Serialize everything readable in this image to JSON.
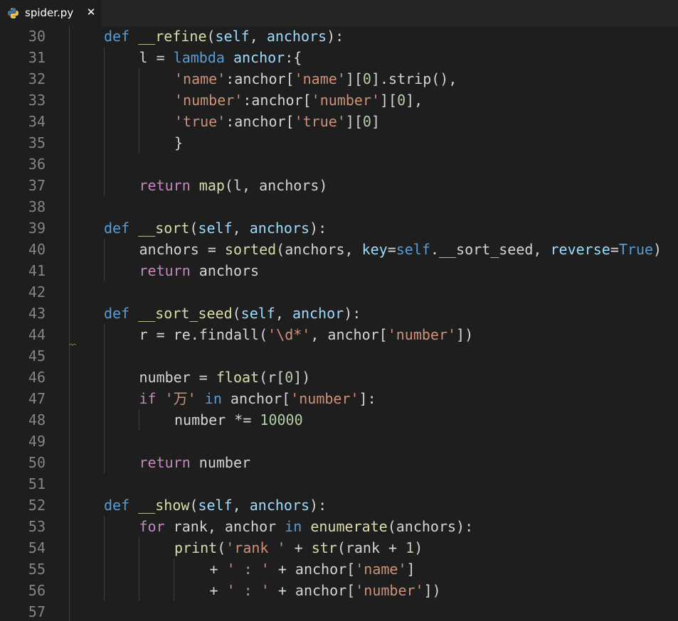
{
  "tab": {
    "filename": "spider.py",
    "close_glyph": "✕",
    "icon": "python-icon"
  },
  "colors": {
    "background": "#1e1e1e",
    "keyword": "#569cd6",
    "control": "#c586c0",
    "function": "#dcdcaa",
    "parameter": "#9cdcfe",
    "string": "#ce9178",
    "number": "#b5cea8",
    "line_number": "#858585"
  },
  "code_lines": [
    {
      "num": "30",
      "tokens": [
        [
          "kw",
          "def"
        ],
        [
          "p",
          " "
        ],
        [
          "fn",
          "__refine"
        ],
        [
          "p",
          "("
        ],
        [
          "param",
          "self"
        ],
        [
          "p",
          ", "
        ],
        [
          "param",
          "anchors"
        ],
        [
          "p",
          "):"
        ]
      ],
      "indent": 0
    },
    {
      "num": "31",
      "tokens": [
        [
          "p",
          "l = "
        ],
        [
          "kw",
          "lambda"
        ],
        [
          "p",
          " "
        ],
        [
          "param",
          "anchor"
        ],
        [
          "p",
          ":{"
        ]
      ],
      "indent": 1
    },
    {
      "num": "32",
      "tokens": [
        [
          "str",
          "'name'"
        ],
        [
          "p",
          ":anchor["
        ],
        [
          "str",
          "'name'"
        ],
        [
          "p",
          "]["
        ],
        [
          "num",
          "0"
        ],
        [
          "p",
          "].strip(),"
        ]
      ],
      "indent": 2
    },
    {
      "num": "33",
      "tokens": [
        [
          "str",
          "'number'"
        ],
        [
          "p",
          ":anchor["
        ],
        [
          "str",
          "'number'"
        ],
        [
          "p",
          "]["
        ],
        [
          "num",
          "0"
        ],
        [
          "p",
          "],"
        ]
      ],
      "indent": 2
    },
    {
      "num": "34",
      "tokens": [
        [
          "str",
          "'true'"
        ],
        [
          "p",
          ":anchor["
        ],
        [
          "str",
          "'true'"
        ],
        [
          "p",
          "]["
        ],
        [
          "num",
          "0"
        ],
        [
          "p",
          "]"
        ]
      ],
      "indent": 2
    },
    {
      "num": "35",
      "tokens": [
        [
          "p",
          "}"
        ]
      ],
      "indent": 2
    },
    {
      "num": "36",
      "tokens": [],
      "indent": 0
    },
    {
      "num": "37",
      "tokens": [
        [
          "ctl",
          "return"
        ],
        [
          "p",
          " "
        ],
        [
          "fn",
          "map"
        ],
        [
          "p",
          "(l, anchors)"
        ]
      ],
      "indent": 1
    },
    {
      "num": "38",
      "tokens": [],
      "indent": 0
    },
    {
      "num": "39",
      "tokens": [
        [
          "kw",
          "def"
        ],
        [
          "p",
          " "
        ],
        [
          "fn",
          "__sort"
        ],
        [
          "p",
          "("
        ],
        [
          "param",
          "self"
        ],
        [
          "p",
          ", "
        ],
        [
          "param",
          "anchors"
        ],
        [
          "p",
          "):"
        ]
      ],
      "indent": 0
    },
    {
      "num": "40",
      "tokens": [
        [
          "p",
          "anchors = "
        ],
        [
          "fn",
          "sorted"
        ],
        [
          "p",
          "(anchors, "
        ],
        [
          "param",
          "key"
        ],
        [
          "p",
          "="
        ],
        [
          "kw",
          "self"
        ],
        [
          "p",
          ".__sort_seed, "
        ],
        [
          "param",
          "reverse"
        ],
        [
          "p",
          "="
        ],
        [
          "kw",
          "True"
        ],
        [
          "p",
          ")"
        ]
      ],
      "indent": 1
    },
    {
      "num": "41",
      "tokens": [
        [
          "ctl",
          "return"
        ],
        [
          "p",
          " anchors"
        ]
      ],
      "indent": 1
    },
    {
      "num": "42",
      "tokens": [],
      "indent": 0
    },
    {
      "num": "43",
      "tokens": [
        [
          "kw",
          "def"
        ],
        [
          "p",
          " "
        ],
        [
          "fn",
          "__sort_seed"
        ],
        [
          "p",
          "("
        ],
        [
          "param",
          "self"
        ],
        [
          "p",
          ", "
        ],
        [
          "param",
          "anchor"
        ],
        [
          "p",
          "):"
        ]
      ],
      "indent": 0
    },
    {
      "num": "44",
      "tokens": [
        [
          "p",
          "r = re.findall("
        ],
        [
          "str",
          "'\\d*'"
        ],
        [
          "p",
          ", anchor["
        ],
        [
          "str",
          "'number'"
        ],
        [
          "p",
          "])"
        ]
      ],
      "indent": 1
    },
    {
      "num": "45",
      "tokens": [],
      "indent": 0
    },
    {
      "num": "46",
      "tokens": [
        [
          "p",
          "number = "
        ],
        [
          "fn",
          "float"
        ],
        [
          "p",
          "(r["
        ],
        [
          "num",
          "0"
        ],
        [
          "p",
          "])"
        ]
      ],
      "indent": 1
    },
    {
      "num": "47",
      "tokens": [
        [
          "ctl",
          "if"
        ],
        [
          "p",
          " "
        ],
        [
          "str",
          "'万'"
        ],
        [
          "p",
          " "
        ],
        [
          "kw",
          "in"
        ],
        [
          "p",
          " anchor["
        ],
        [
          "str",
          "'number'"
        ],
        [
          "p",
          "]:"
        ]
      ],
      "indent": 1
    },
    {
      "num": "48",
      "tokens": [
        [
          "p",
          "number *= "
        ],
        [
          "num",
          "10000"
        ]
      ],
      "indent": 2
    },
    {
      "num": "49",
      "tokens": [],
      "indent": 0
    },
    {
      "num": "50",
      "tokens": [
        [
          "ctl",
          "return"
        ],
        [
          "p",
          " number"
        ]
      ],
      "indent": 1
    },
    {
      "num": "51",
      "tokens": [],
      "indent": 0
    },
    {
      "num": "52",
      "tokens": [
        [
          "kw",
          "def"
        ],
        [
          "p",
          " "
        ],
        [
          "fn",
          "__show"
        ],
        [
          "p",
          "("
        ],
        [
          "param",
          "self"
        ],
        [
          "p",
          ", "
        ],
        [
          "param",
          "anchors"
        ],
        [
          "p",
          "):"
        ]
      ],
      "indent": 0
    },
    {
      "num": "53",
      "tokens": [
        [
          "ctl",
          "for"
        ],
        [
          "p",
          " rank, anchor "
        ],
        [
          "kw",
          "in"
        ],
        [
          "p",
          " "
        ],
        [
          "fn",
          "enumerate"
        ],
        [
          "p",
          "(anchors):"
        ]
      ],
      "indent": 1
    },
    {
      "num": "54",
      "tokens": [
        [
          "fn",
          "print"
        ],
        [
          "p",
          "("
        ],
        [
          "str",
          "'rank '"
        ],
        [
          "p",
          " + "
        ],
        [
          "fn",
          "str"
        ],
        [
          "p",
          "(rank + "
        ],
        [
          "num",
          "1"
        ],
        [
          "p",
          ")"
        ]
      ],
      "indent": 2
    },
    {
      "num": "55",
      "tokens": [
        [
          "p",
          "+ "
        ],
        [
          "str",
          "' : '"
        ],
        [
          "p",
          " + anchor["
        ],
        [
          "str",
          "'name'"
        ],
        [
          "p",
          "]"
        ]
      ],
      "indent": 3
    },
    {
      "num": "56",
      "tokens": [
        [
          "p",
          "+ "
        ],
        [
          "str",
          "' : '"
        ],
        [
          "p",
          " + anchor["
        ],
        [
          "str",
          "'number'"
        ],
        [
          "p",
          "])"
        ]
      ],
      "indent": 3
    },
    {
      "num": "57",
      "tokens": [],
      "indent": 0
    }
  ]
}
